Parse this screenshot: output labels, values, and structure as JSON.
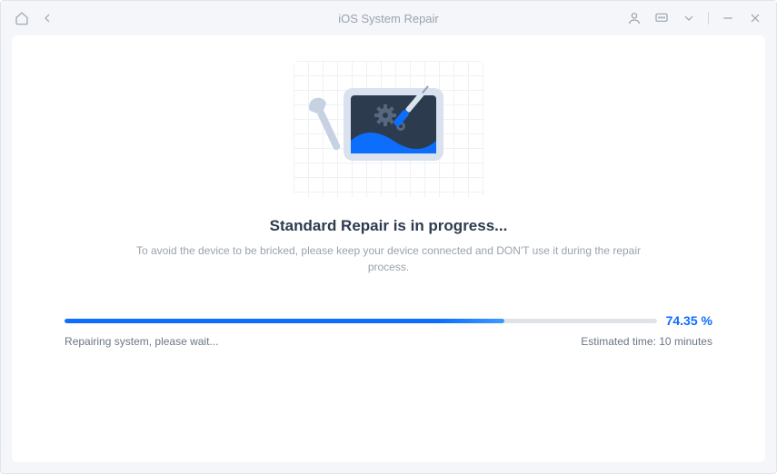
{
  "titlebar": {
    "title": "iOS System Repair"
  },
  "main": {
    "heading": "Standard Repair is in progress...",
    "subtext": "To avoid the device to be bricked, please keep your device connected and DON'T use it during the repair process."
  },
  "progress": {
    "percent_value": 74.35,
    "percent_display": "74.35 %",
    "status_text": "Repairing system, please wait...",
    "eta_text": "Estimated time: 10 minutes",
    "bar_width_css": "74.35%"
  },
  "colors": {
    "accent": "#0d6efd",
    "text_primary": "#2d3b4e",
    "text_muted": "#9aa3ae"
  }
}
